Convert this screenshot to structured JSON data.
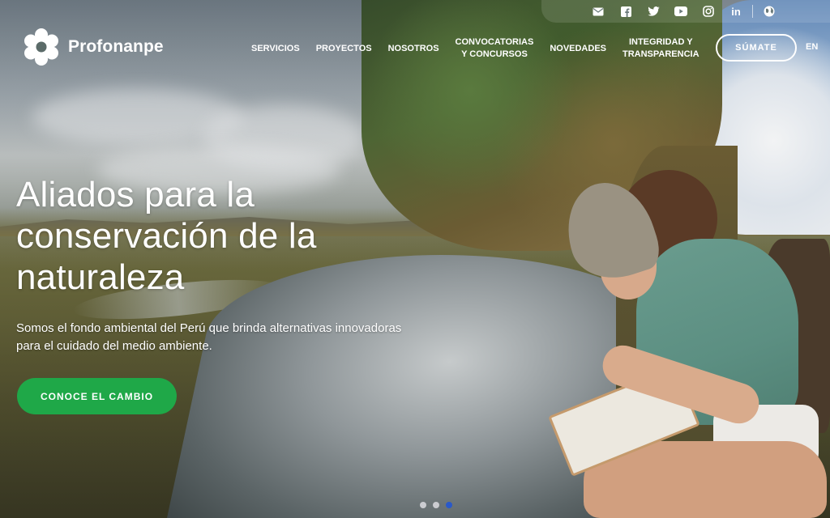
{
  "brand": {
    "name": "Profonanpe"
  },
  "social": {
    "icons": [
      "email-icon",
      "facebook-icon",
      "twitter-icon",
      "youtube-icon",
      "instagram-icon",
      "linkedin-icon",
      "globe-icon"
    ],
    "linkedin_text": "in"
  },
  "nav": {
    "items": [
      {
        "label": "SERVICIOS"
      },
      {
        "label": "PROYECTOS"
      },
      {
        "label": "NOSOTROS"
      },
      {
        "label": "CONVOCATORIAS\nY CONCURSOS"
      },
      {
        "label": "NOVEDADES"
      },
      {
        "label": "INTEGRIDAD Y\nTRANSPARENCIA"
      }
    ],
    "join_label": "SÚMATE",
    "lang_label": "EN"
  },
  "hero": {
    "headline": "Aliados para la conservación de la naturaleza",
    "subtext": "Somos el fondo ambiental del Perú que brinda alternativas innovadoras para el cuidado del medio ambiente.",
    "cta_label": "CONOCE EL CAMBIO"
  },
  "carousel": {
    "slide_count": 3,
    "active_slide": 3
  },
  "colors": {
    "cta_green": "#1fa848",
    "active_dot": "#2a59c9"
  }
}
